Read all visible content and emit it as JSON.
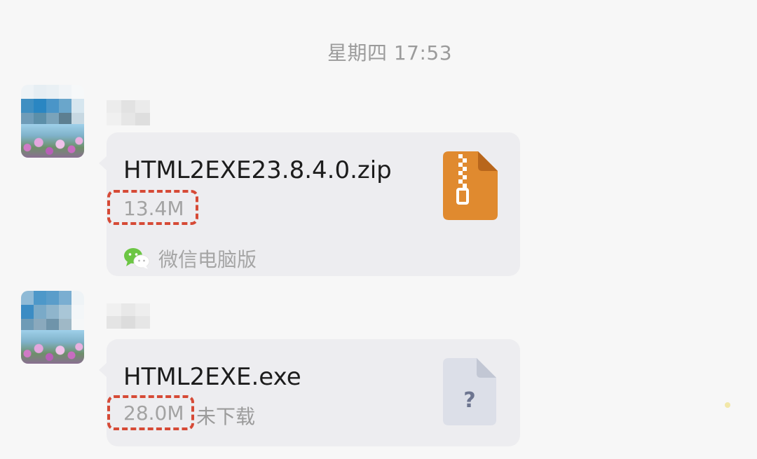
{
  "chat": {
    "timestamp": "星期四 17:53",
    "messages": [
      {
        "type": "file",
        "file_name": "HTML2EXE23.8.4.0.zip",
        "file_size": "13.4M",
        "file_icon": "zip-file-icon",
        "file_icon_color": "#e08a2f",
        "source_icon": "wechat-icon",
        "source_label": "微信电脑版"
      },
      {
        "type": "file",
        "file_name": "HTML2EXE.exe",
        "file_size": "28.0M",
        "status": "未下载",
        "file_icon": "unknown-file-icon",
        "file_icon_color": "#dcdfe8"
      }
    ]
  },
  "colors": {
    "highlight": "#d64a36",
    "bubble": "#ededf0",
    "background": "#f7f7f7"
  }
}
